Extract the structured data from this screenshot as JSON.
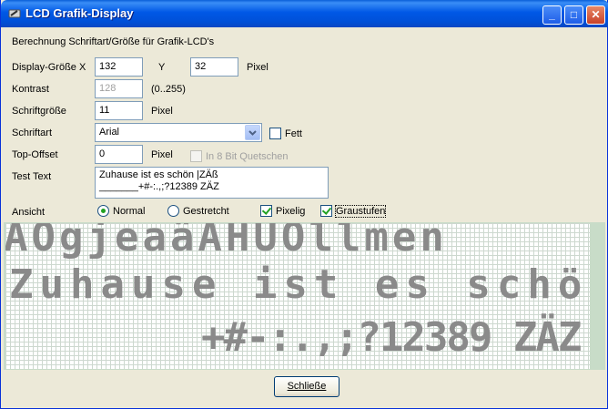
{
  "window": {
    "title": "LCD Grafik-Display",
    "minimize": "_",
    "maximize": "□",
    "close": "✕"
  },
  "heading": "Berechnung Schriftart/Größe für Grafik-LCD's",
  "display": {
    "label_x": "Display-Größe X",
    "value_x": "132",
    "label_y": "Y",
    "value_y": "32",
    "unit": "Pixel"
  },
  "contrast": {
    "label": "Kontrast",
    "value": "128",
    "range": "(0..255)"
  },
  "fontsize": {
    "label": "Schriftgröße",
    "value": "11",
    "unit": "Pixel"
  },
  "font": {
    "label": "Schriftart",
    "value": "Arial",
    "bold_label": "Fett",
    "bold_checked": false
  },
  "topoffset": {
    "label": "Top-Offset",
    "value": "0",
    "unit": "Pixel",
    "quetschen_label": "In 8 Bit Quetschen"
  },
  "testtext": {
    "label": "Test Text",
    "value": "Zuhause ist es schön |ZÄß\n_______+#-:.,;?12389 ZÄZ"
  },
  "view": {
    "label": "Ansicht",
    "normal": "Normal",
    "stretched": "Gestretcht",
    "pixelig": "Pixelig",
    "graustufen": "Graustufen"
  },
  "lcd_lines": [
    "AÖgjeaäÄHÜÖllmen",
    "Zuhause ist es schön |ZÄß",
    "+#-:.,;?12389 ZÄZ"
  ],
  "close_button": "Schließe",
  "colors": {
    "titlebar": "#0058e6",
    "face": "#ece9d8",
    "lcd_grid": "#cdd8cf",
    "lcd_bg": "#c8dcc8"
  }
}
